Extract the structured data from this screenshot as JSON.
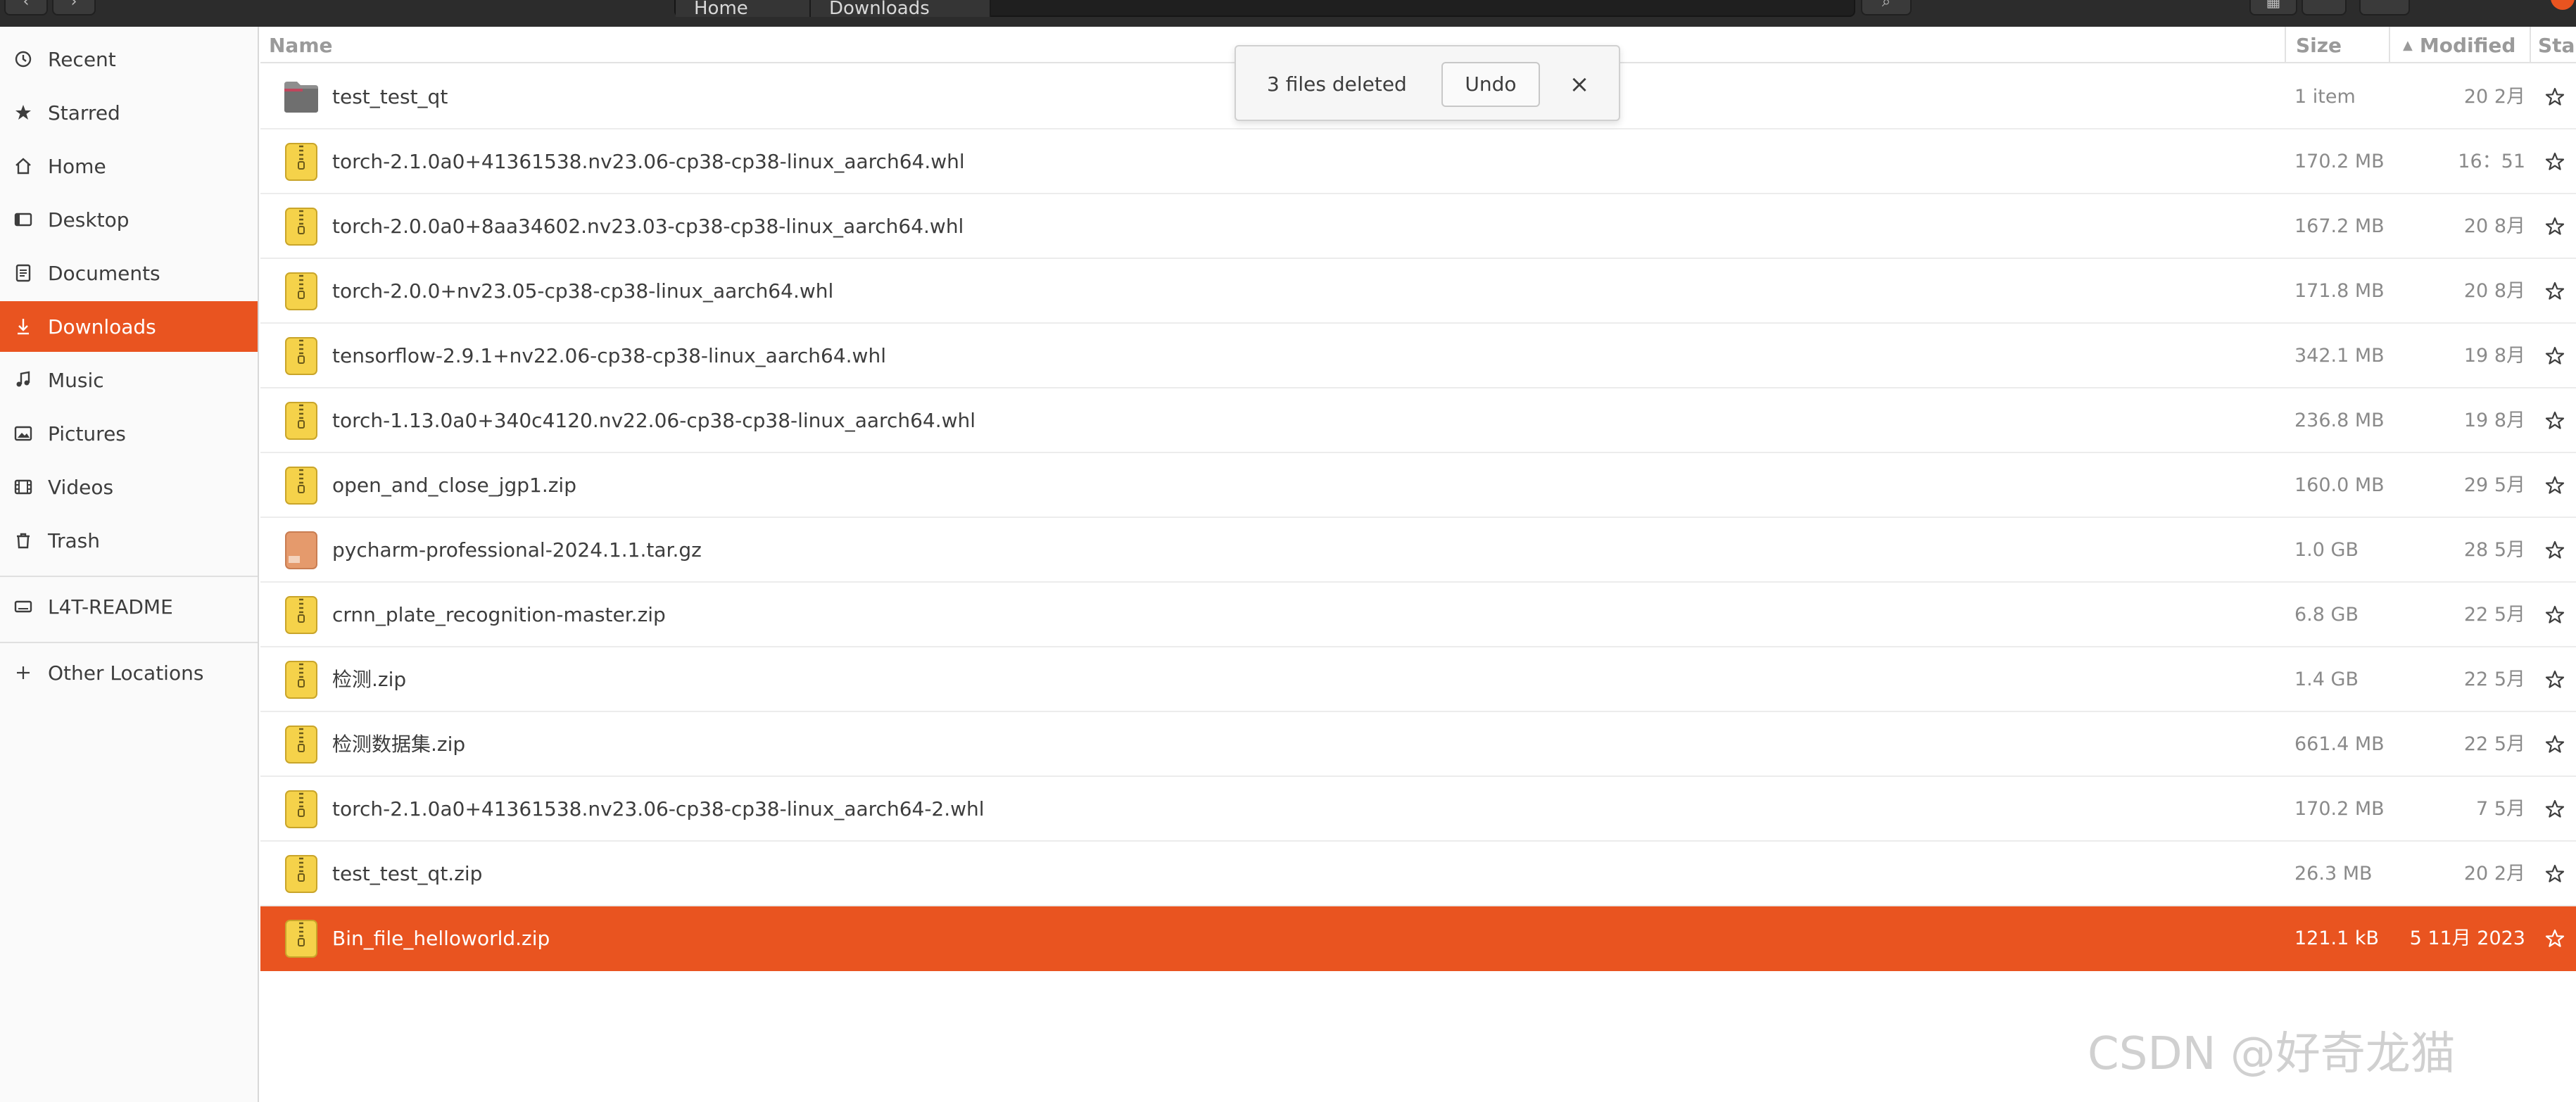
{
  "header": {
    "back_icon": "chevron-left-icon",
    "forward_icon": "chevron-right-icon",
    "path": [
      "Home",
      "Downloads"
    ],
    "search_icon": "search-icon",
    "view_icon": "grid-view-icon",
    "accent_color": "#e95420"
  },
  "sidebar": {
    "items": [
      {
        "label": "Recent",
        "icon": "clock-icon"
      },
      {
        "label": "Starred",
        "icon": "star-icon"
      },
      {
        "label": "Home",
        "icon": "home-icon"
      },
      {
        "label": "Desktop",
        "icon": "desktop-icon"
      },
      {
        "label": "Documents",
        "icon": "document-icon"
      },
      {
        "label": "Downloads",
        "icon": "download-icon",
        "active": true
      },
      {
        "label": "Music",
        "icon": "music-icon"
      },
      {
        "label": "Pictures",
        "icon": "picture-icon"
      },
      {
        "label": "Videos",
        "icon": "video-icon"
      },
      {
        "label": "Trash",
        "icon": "trash-icon"
      }
    ],
    "devices": [
      {
        "label": "L4T-README",
        "icon": "drive-icon"
      }
    ],
    "other": {
      "label": "Other Locations",
      "icon": "plus-icon"
    }
  },
  "columns": {
    "name": "Name",
    "size": "Size",
    "modified": "Modified",
    "star": "Star",
    "sort_icon": "sort-ascending-icon"
  },
  "files": [
    {
      "name": "test_test_qt",
      "size": "1 item",
      "modified": "20 2月",
      "type": "folder"
    },
    {
      "name": "torch-2.1.0a0+41361538.nv23.06-cp38-cp38-linux_aarch64.whl",
      "size": "170.2 MB",
      "modified": "16：51",
      "type": "zip"
    },
    {
      "name": "torch-2.0.0a0+8aa34602.nv23.03-cp38-cp38-linux_aarch64.whl",
      "size": "167.2 MB",
      "modified": "20 8月",
      "type": "zip"
    },
    {
      "name": "torch-2.0.0+nv23.05-cp38-cp38-linux_aarch64.whl",
      "size": "171.8 MB",
      "modified": "20 8月",
      "type": "zip"
    },
    {
      "name": "tensorflow-2.9.1+nv22.06-cp38-cp38-linux_aarch64.whl",
      "size": "342.1 MB",
      "modified": "19 8月",
      "type": "zip"
    },
    {
      "name": "torch-1.13.0a0+340c4120.nv22.06-cp38-cp38-linux_aarch64.whl",
      "size": "236.8 MB",
      "modified": "19 8月",
      "type": "zip"
    },
    {
      "name": "open_and_close_jgp1.zip",
      "size": "160.0 MB",
      "modified": "29 5月",
      "type": "zip"
    },
    {
      "name": "pycharm-professional-2024.1.1.tar.gz",
      "size": "1.0 GB",
      "modified": "28 5月",
      "type": "archive"
    },
    {
      "name": "crnn_plate_recognition-master.zip",
      "size": "6.8 GB",
      "modified": "22 5月",
      "type": "zip"
    },
    {
      "name": "检测.zip",
      "size": "1.4 GB",
      "modified": "22 5月",
      "type": "zip"
    },
    {
      "name": "检测数据集.zip",
      "size": "661.4 MB",
      "modified": "22 5月",
      "type": "zip"
    },
    {
      "name": "torch-2.1.0a0+41361538.nv23.06-cp38-cp38-linux_aarch64-2.whl",
      "size": "170.2 MB",
      "modified": "7 5月",
      "type": "zip"
    },
    {
      "name": "test_test_qt.zip",
      "size": "26.3 MB",
      "modified": "20 2月",
      "type": "zip"
    },
    {
      "name": "Bin_file_helloworld.zip",
      "size": "121.1 kB",
      "modified": "5 11月 2023",
      "type": "zip",
      "selected": true
    }
  ],
  "toast": {
    "message": "3 files deleted",
    "undo_label": "Undo",
    "close_label": "×"
  },
  "watermark": "CSDN @好奇龙猫"
}
